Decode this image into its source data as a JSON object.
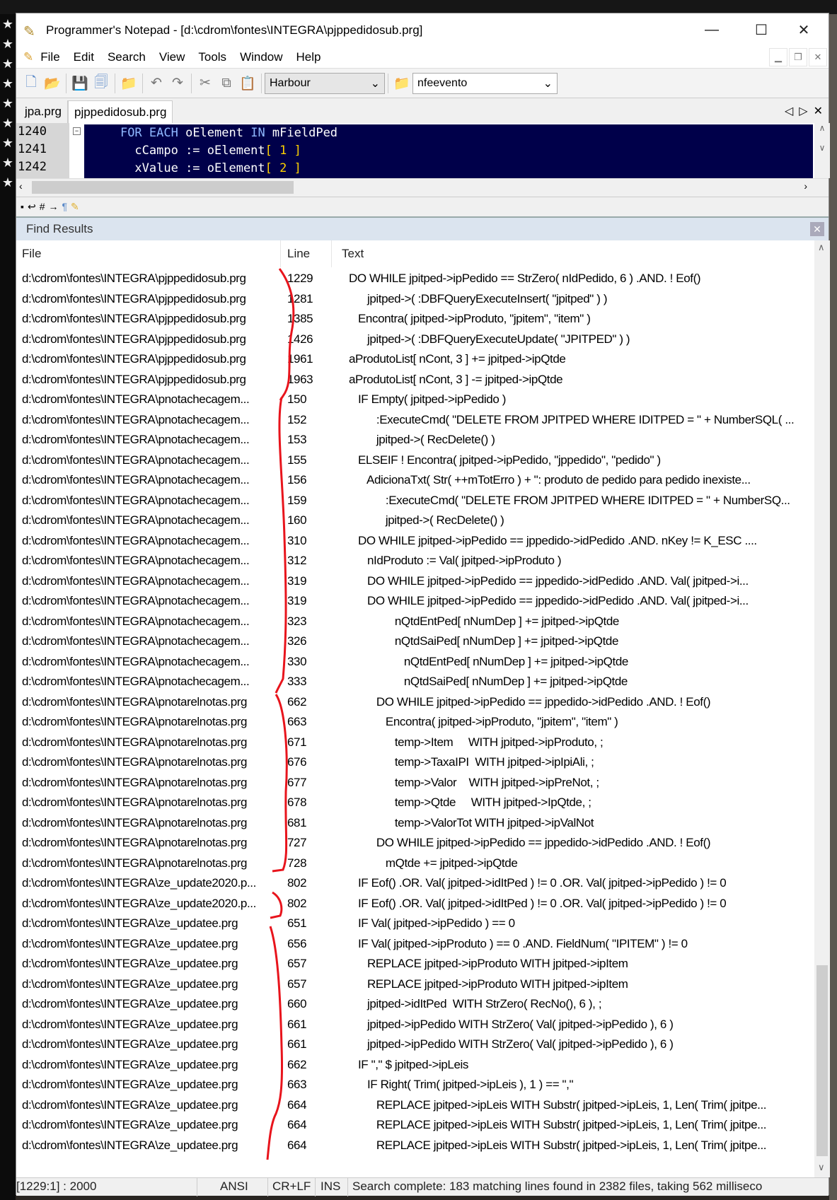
{
  "window": {
    "title": "Programmer's Notepad - [d:\\cdrom\\fontes\\INTEGRA\\pjppedidosub.prg]"
  },
  "menu": [
    "File",
    "Edit",
    "Search",
    "View",
    "Tools",
    "Window",
    "Help"
  ],
  "toolbar": {
    "scheme": "Harbour",
    "search": "nfeevento"
  },
  "tabs": [
    "jpa.prg",
    "pjppedidosub.prg"
  ],
  "editor": {
    "line_numbers": [
      "1240",
      "1241",
      "1242"
    ],
    "lines": [
      {
        "indent": "    ",
        "kw1": "FOR EACH",
        "a": " oElement ",
        "kw2": "IN",
        "b": " mFieldPed",
        "num": ""
      },
      {
        "indent": "      ",
        "a": "cCampo := oElement",
        "br1": "[ ",
        "num": "1",
        "br2": " ]"
      },
      {
        "indent": "      ",
        "a": "xValue := oElement",
        "br1": "[ ",
        "num": "2",
        "br2": " ]"
      }
    ]
  },
  "find": {
    "title": "Find Results",
    "columns": [
      "File",
      "Line",
      "Text"
    ],
    "rows": [
      [
        "d:\\cdrom\\fontes\\INTEGRA\\pjppedidosub.prg",
        "1229",
        "DO WHILE jpitped->ipPedido == StrZero( nIdPedido, 6 ) .AND. ! Eof()"
      ],
      [
        "d:\\cdrom\\fontes\\INTEGRA\\pjppedidosub.prg",
        "1281",
        "      jpitped->( :DBFQueryExecuteInsert( \"jpitped\" ) )"
      ],
      [
        "d:\\cdrom\\fontes\\INTEGRA\\pjppedidosub.prg",
        "1385",
        "   Encontra( jpitped->ipProduto, \"jpitem\", \"item\" )"
      ],
      [
        "d:\\cdrom\\fontes\\INTEGRA\\pjppedidosub.prg",
        "1426",
        "      jpitped->( :DBFQueryExecuteUpdate( \"JPITPED\" ) )"
      ],
      [
        "d:\\cdrom\\fontes\\INTEGRA\\pjppedidosub.prg",
        "1961",
        "aProdutoList[ nCont, 3 ] += jpitped->ipQtde"
      ],
      [
        "d:\\cdrom\\fontes\\INTEGRA\\pjppedidosub.prg",
        "1963",
        "aProdutoList[ nCont, 3 ] -= jpitped->ipQtde"
      ],
      [
        "d:\\cdrom\\fontes\\INTEGRA\\pnotachecagem...",
        "150",
        "   IF Empty( jpitped->ipPedido )"
      ],
      [
        "d:\\cdrom\\fontes\\INTEGRA\\pnotachecagem...",
        "152",
        "         :ExecuteCmd( \"DELETE FROM JPITPED WHERE IDITPED = \" + NumberSQL( ..."
      ],
      [
        "d:\\cdrom\\fontes\\INTEGRA\\pnotachecagem...",
        "153",
        "         jpitped->( RecDelete() )"
      ],
      [
        "d:\\cdrom\\fontes\\INTEGRA\\pnotachecagem...",
        "155",
        "   ELSEIF ! Encontra( jpitped->ipPedido, \"jppedido\", \"pedido\" )"
      ],
      [
        "d:\\cdrom\\fontes\\INTEGRA\\pnotachecagem...",
        "156",
        "      AdicionaTxt( Str( ++mTotErro ) + \": produto de pedido para pedido inexiste..."
      ],
      [
        "d:\\cdrom\\fontes\\INTEGRA\\pnotachecagem...",
        "159",
        "            :ExecuteCmd( \"DELETE FROM JPITPED WHERE IDITPED = \" + NumberSQ..."
      ],
      [
        "d:\\cdrom\\fontes\\INTEGRA\\pnotachecagem...",
        "160",
        "            jpitped->( RecDelete() )"
      ],
      [
        "d:\\cdrom\\fontes\\INTEGRA\\pnotachecagem...",
        "310",
        "   DO WHILE jpitped->ipPedido == jppedido->idPedido .AND. nKey != K_ESC ...."
      ],
      [
        "d:\\cdrom\\fontes\\INTEGRA\\pnotachecagem...",
        "312",
        "      nIdProduto := Val( jpitped->ipProduto )"
      ],
      [
        "d:\\cdrom\\fontes\\INTEGRA\\pnotachecagem...",
        "319",
        "      DO WHILE jpitped->ipPedido == jppedido->idPedido .AND. Val( jpitped->i..."
      ],
      [
        "d:\\cdrom\\fontes\\INTEGRA\\pnotachecagem...",
        "319",
        "      DO WHILE jpitped->ipPedido == jppedido->idPedido .AND. Val( jpitped->i..."
      ],
      [
        "d:\\cdrom\\fontes\\INTEGRA\\pnotachecagem...",
        "323",
        "               nQtdEntPed[ nNumDep ] += jpitped->ipQtde"
      ],
      [
        "d:\\cdrom\\fontes\\INTEGRA\\pnotachecagem...",
        "326",
        "               nQtdSaiPed[ nNumDep ] += jpitped->ipQtde"
      ],
      [
        "d:\\cdrom\\fontes\\INTEGRA\\pnotachecagem...",
        "330",
        "                  nQtdEntPed[ nNumDep ] += jpitped->ipQtde"
      ],
      [
        "d:\\cdrom\\fontes\\INTEGRA\\pnotachecagem...",
        "333",
        "                  nQtdSaiPed[ nNumDep ] += jpitped->ipQtde"
      ],
      [
        "d:\\cdrom\\fontes\\INTEGRA\\pnotarelnotas.prg",
        "662",
        "         DO WHILE jpitped->ipPedido == jppedido->idPedido .AND. ! Eof()"
      ],
      [
        "d:\\cdrom\\fontes\\INTEGRA\\pnotarelnotas.prg",
        "663",
        "            Encontra( jpitped->ipProduto, \"jpitem\", \"item\" )"
      ],
      [
        "d:\\cdrom\\fontes\\INTEGRA\\pnotarelnotas.prg",
        "671",
        "               temp->Item     WITH jpitped->ipProduto, ;"
      ],
      [
        "d:\\cdrom\\fontes\\INTEGRA\\pnotarelnotas.prg",
        "676",
        "               temp->TaxaIPI  WITH jpitped->ipIpiAli, ;"
      ],
      [
        "d:\\cdrom\\fontes\\INTEGRA\\pnotarelnotas.prg",
        "677",
        "               temp->Valor    WITH jpitped->ipPreNot, ;"
      ],
      [
        "d:\\cdrom\\fontes\\INTEGRA\\pnotarelnotas.prg",
        "678",
        "               temp->Qtde     WITH jpitped->IpQtde, ;"
      ],
      [
        "d:\\cdrom\\fontes\\INTEGRA\\pnotarelnotas.prg",
        "681",
        "               temp->ValorTot WITH jpitped->ipValNot"
      ],
      [
        "d:\\cdrom\\fontes\\INTEGRA\\pnotarelnotas.prg",
        "727",
        "         DO WHILE jpitped->ipPedido == jppedido->idPedido .AND. ! Eof()"
      ],
      [
        "d:\\cdrom\\fontes\\INTEGRA\\pnotarelnotas.prg",
        "728",
        "            mQtde += jpitped->ipQtde"
      ],
      [
        "d:\\cdrom\\fontes\\INTEGRA\\ze_update2020.p...",
        "802",
        "   IF Eof() .OR. Val( jpitped->idItPed ) != 0 .OR. Val( jpitped->ipPedido ) != 0"
      ],
      [
        "d:\\cdrom\\fontes\\INTEGRA\\ze_update2020.p...",
        "802",
        "   IF Eof() .OR. Val( jpitped->idItPed ) != 0 .OR. Val( jpitped->ipPedido ) != 0"
      ],
      [
        "d:\\cdrom\\fontes\\INTEGRA\\ze_updatee.prg",
        "651",
        "   IF Val( jpitped->ipPedido ) == 0"
      ],
      [
        "d:\\cdrom\\fontes\\INTEGRA\\ze_updatee.prg",
        "656",
        "   IF Val( jpitped->ipProduto ) == 0 .AND. FieldNum( \"IPITEM\" ) != 0"
      ],
      [
        "d:\\cdrom\\fontes\\INTEGRA\\ze_updatee.prg",
        "657",
        "      REPLACE jpitped->ipProduto WITH jpitped->ipItem"
      ],
      [
        "d:\\cdrom\\fontes\\INTEGRA\\ze_updatee.prg",
        "657",
        "      REPLACE jpitped->ipProduto WITH jpitped->ipItem"
      ],
      [
        "d:\\cdrom\\fontes\\INTEGRA\\ze_updatee.prg",
        "660",
        "      jpitped->idItPed  WITH StrZero( RecNo(), 6 ), ;"
      ],
      [
        "d:\\cdrom\\fontes\\INTEGRA\\ze_updatee.prg",
        "661",
        "      jpitped->ipPedido WITH StrZero( Val( jpitped->ipPedido ), 6 )"
      ],
      [
        "d:\\cdrom\\fontes\\INTEGRA\\ze_updatee.prg",
        "661",
        "      jpitped->ipPedido WITH StrZero( Val( jpitped->ipPedido ), 6 )"
      ],
      [
        "d:\\cdrom\\fontes\\INTEGRA\\ze_updatee.prg",
        "662",
        "   IF \",\" $ jpitped->ipLeis"
      ],
      [
        "d:\\cdrom\\fontes\\INTEGRA\\ze_updatee.prg",
        "663",
        "      IF Right( Trim( jpitped->ipLeis ), 1 ) == \",\""
      ],
      [
        "d:\\cdrom\\fontes\\INTEGRA\\ze_updatee.prg",
        "664",
        "         REPLACE jpitped->ipLeis WITH Substr( jpitped->ipLeis, 1, Len( Trim( jpitpe..."
      ],
      [
        "d:\\cdrom\\fontes\\INTEGRA\\ze_updatee.prg",
        "664",
        "         REPLACE jpitped->ipLeis WITH Substr( jpitped->ipLeis, 1, Len( Trim( jpitpe..."
      ],
      [
        "d:\\cdrom\\fontes\\INTEGRA\\ze_updatee.prg",
        "664",
        "         REPLACE jpitped->ipLeis WITH Substr( jpitped->ipLeis, 1, Len( Trim( jpitpe..."
      ]
    ]
  },
  "status": {
    "position": "[1229:1] : 2000",
    "encoding": "ANSI",
    "eol": "CR+LF",
    "mode": "INS",
    "message": "Search complete: 183 matching lines found in 2382 files, taking 562 milliseco"
  },
  "colors": {
    "editor_bg": "#00004a",
    "annotation": "#e8141c",
    "find_header": "#dbe4ef"
  }
}
